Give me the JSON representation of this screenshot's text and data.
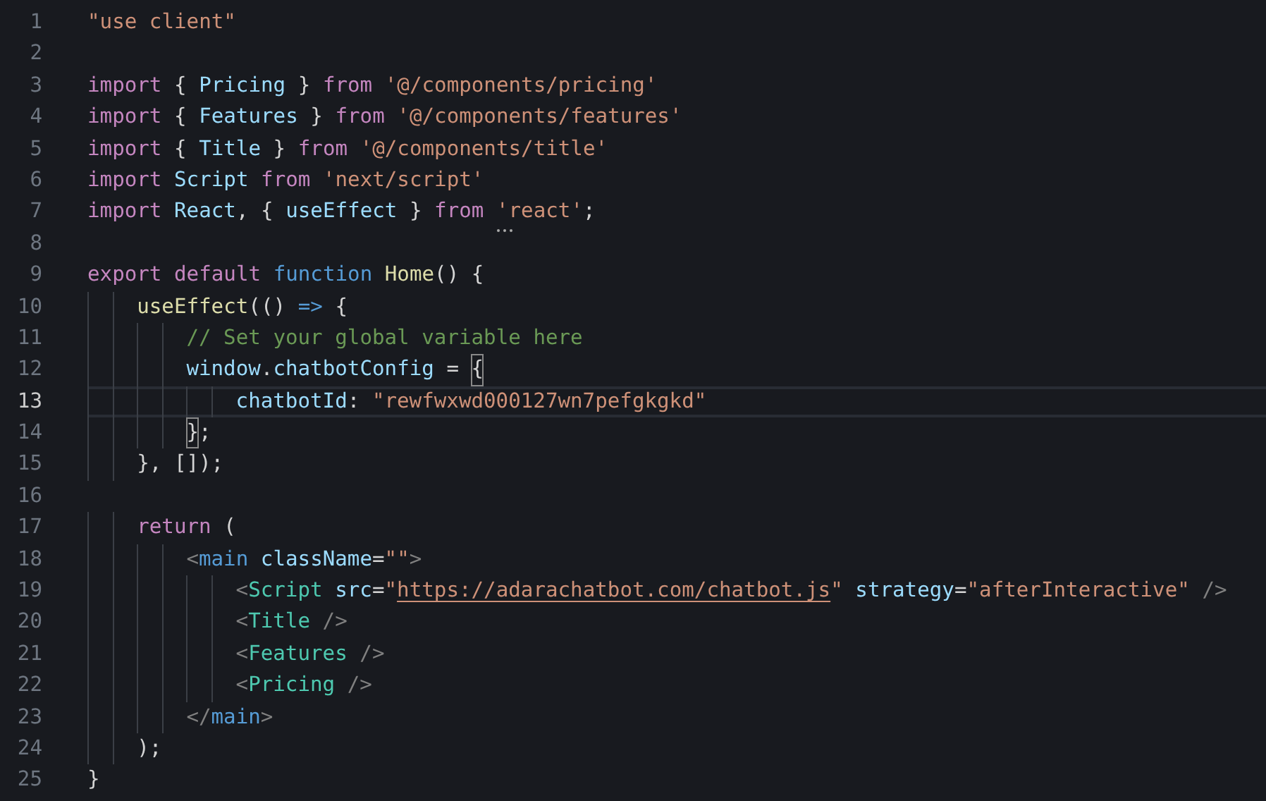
{
  "editor": {
    "lines": [
      {
        "number": "1",
        "current": false,
        "tokens": [
          {
            "kind": "string",
            "text": "\"use client\""
          }
        ]
      },
      {
        "number": "2",
        "current": false
      },
      {
        "number": "3",
        "current": false,
        "tokens": [
          {
            "kind": "keyword",
            "text": "import"
          },
          {
            "kind": "punct",
            "text": " { "
          },
          {
            "kind": "variable",
            "text": "Pricing"
          },
          {
            "kind": "punct",
            "text": " } "
          },
          {
            "kind": "keyword",
            "text": "from "
          },
          {
            "kind": "string",
            "text": "'@/components/pricing'"
          }
        ]
      },
      {
        "number": "4",
        "current": false,
        "tokens": [
          {
            "kind": "keyword",
            "text": "import"
          },
          {
            "kind": "punct",
            "text": " { "
          },
          {
            "kind": "variable",
            "text": "Features"
          },
          {
            "kind": "punct",
            "text": " } "
          },
          {
            "kind": "keyword",
            "text": "from "
          },
          {
            "kind": "string",
            "text": "'@/components/features'"
          }
        ]
      },
      {
        "number": "5",
        "current": false,
        "tokens": [
          {
            "kind": "keyword",
            "text": "import"
          },
          {
            "kind": "punct",
            "text": " { "
          },
          {
            "kind": "variable",
            "text": "Title"
          },
          {
            "kind": "punct",
            "text": " } "
          },
          {
            "kind": "keyword",
            "text": "from "
          },
          {
            "kind": "string",
            "text": "'@/components/title'"
          }
        ]
      },
      {
        "number": "6",
        "current": false,
        "tokens": [
          {
            "kind": "keyword",
            "text": "import "
          },
          {
            "kind": "variable",
            "text": "Script "
          },
          {
            "kind": "keyword",
            "text": "from "
          },
          {
            "kind": "string",
            "text": "'next/script'"
          }
        ]
      },
      {
        "number": "7",
        "current": false,
        "tokens": [
          {
            "kind": "keyword",
            "text": "import "
          },
          {
            "kind": "variable",
            "text": "React"
          },
          {
            "kind": "punct",
            "text": ", { "
          },
          {
            "kind": "variable",
            "text": "useEffect"
          },
          {
            "kind": "punct",
            "text": " } "
          },
          {
            "kind": "keyword",
            "text": "from "
          },
          {
            "kind": "string",
            "text": "'react'",
            "hint": true
          },
          {
            "kind": "punct",
            "text": ";"
          }
        ]
      },
      {
        "number": "8",
        "current": false
      },
      {
        "number": "9",
        "current": false,
        "tokens": [
          {
            "kind": "keyword",
            "text": "export "
          },
          {
            "kind": "keyword",
            "text": "default "
          },
          {
            "kind": "storage",
            "text": "function "
          },
          {
            "kind": "function",
            "text": "Home"
          },
          {
            "kind": "punct",
            "text": "() {"
          }
        ]
      },
      {
        "number": "10",
        "current": false,
        "tokens": [
          {
            "kind": "function",
            "text": "    useEffect"
          },
          {
            "kind": "punct",
            "text": "(() "
          },
          {
            "kind": "storage",
            "text": "=>"
          },
          {
            "kind": "punct",
            "text": " {"
          }
        ]
      },
      {
        "number": "11",
        "current": false,
        "tokens": [
          {
            "kind": "comment",
            "text": "        // Set your global variable here"
          }
        ]
      },
      {
        "number": "12",
        "current": false,
        "tokens": [
          {
            "kind": "variable",
            "text": "        window"
          },
          {
            "kind": "punct",
            "text": "."
          },
          {
            "kind": "variable",
            "text": "chatbotConfig"
          },
          {
            "kind": "punct",
            "text": " = "
          },
          {
            "kind": "punct",
            "text": "{",
            "matched": true
          }
        ]
      },
      {
        "number": "13",
        "current": true,
        "tokens": [
          {
            "kind": "variable",
            "text": "            chatbotId"
          },
          {
            "kind": "punct",
            "text": ": "
          },
          {
            "kind": "string",
            "text": "\"rewfwxwd000127wn7pefgkgkd\""
          }
        ]
      },
      {
        "number": "14",
        "current": false,
        "tokens": [
          {
            "kind": "punct",
            "text": "        }",
            "matched": true
          },
          {
            "kind": "punct",
            "text": ";"
          }
        ]
      },
      {
        "number": "15",
        "current": false,
        "tokens": [
          {
            "kind": "punct",
            "text": "    }, []);"
          }
        ]
      },
      {
        "number": "16",
        "current": false
      },
      {
        "number": "17",
        "current": false,
        "tokens": [
          {
            "kind": "keyword",
            "text": "    return"
          },
          {
            "kind": "punct",
            "text": " ("
          }
        ]
      },
      {
        "number": "18",
        "current": false,
        "tokens": [
          {
            "kind": "tagpunct",
            "text": "        <"
          },
          {
            "kind": "tag",
            "text": "main "
          },
          {
            "kind": "attribute",
            "text": "className"
          },
          {
            "kind": "punct",
            "text": "="
          },
          {
            "kind": "string",
            "text": "\"\""
          },
          {
            "kind": "tagpunct",
            "text": ">"
          }
        ]
      },
      {
        "number": "19",
        "current": false,
        "tokens": [
          {
            "kind": "tagpunct",
            "text": "            <"
          },
          {
            "kind": "component",
            "text": "Script "
          },
          {
            "kind": "attribute",
            "text": "src"
          },
          {
            "kind": "punct",
            "text": "="
          },
          {
            "kind": "string",
            "text": "\""
          },
          {
            "kind": "link",
            "text": "https://adarachatbot.com/chatbot.js"
          },
          {
            "kind": "string",
            "text": "\" "
          },
          {
            "kind": "attribute",
            "text": "strategy"
          },
          {
            "kind": "punct",
            "text": "="
          },
          {
            "kind": "string",
            "text": "\"afterInteractive\""
          },
          {
            "kind": "tagpunct",
            "text": " />"
          }
        ]
      },
      {
        "number": "20",
        "current": false,
        "tokens": [
          {
            "kind": "tagpunct",
            "text": "            <"
          },
          {
            "kind": "component",
            "text": "Title"
          },
          {
            "kind": "tagpunct",
            "text": " />"
          }
        ]
      },
      {
        "number": "21",
        "current": false,
        "tokens": [
          {
            "kind": "tagpunct",
            "text": "            <"
          },
          {
            "kind": "component",
            "text": "Features"
          },
          {
            "kind": "tagpunct",
            "text": " />"
          }
        ]
      },
      {
        "number": "22",
        "current": false,
        "tokens": [
          {
            "kind": "tagpunct",
            "text": "            <"
          },
          {
            "kind": "component",
            "text": "Pricing"
          },
          {
            "kind": "tagpunct",
            "text": " />"
          }
        ]
      },
      {
        "number": "23",
        "current": false,
        "tokens": [
          {
            "kind": "tagpunct",
            "text": "        </"
          },
          {
            "kind": "tag",
            "text": "main"
          },
          {
            "kind": "tagpunct",
            "text": ">"
          }
        ]
      },
      {
        "number": "24",
        "current": false,
        "tokens": [
          {
            "kind": "punct",
            "text": "    );"
          }
        ]
      },
      {
        "number": "25",
        "current": false,
        "tokens": [
          {
            "kind": "punct",
            "text": "}"
          }
        ]
      }
    ]
  }
}
